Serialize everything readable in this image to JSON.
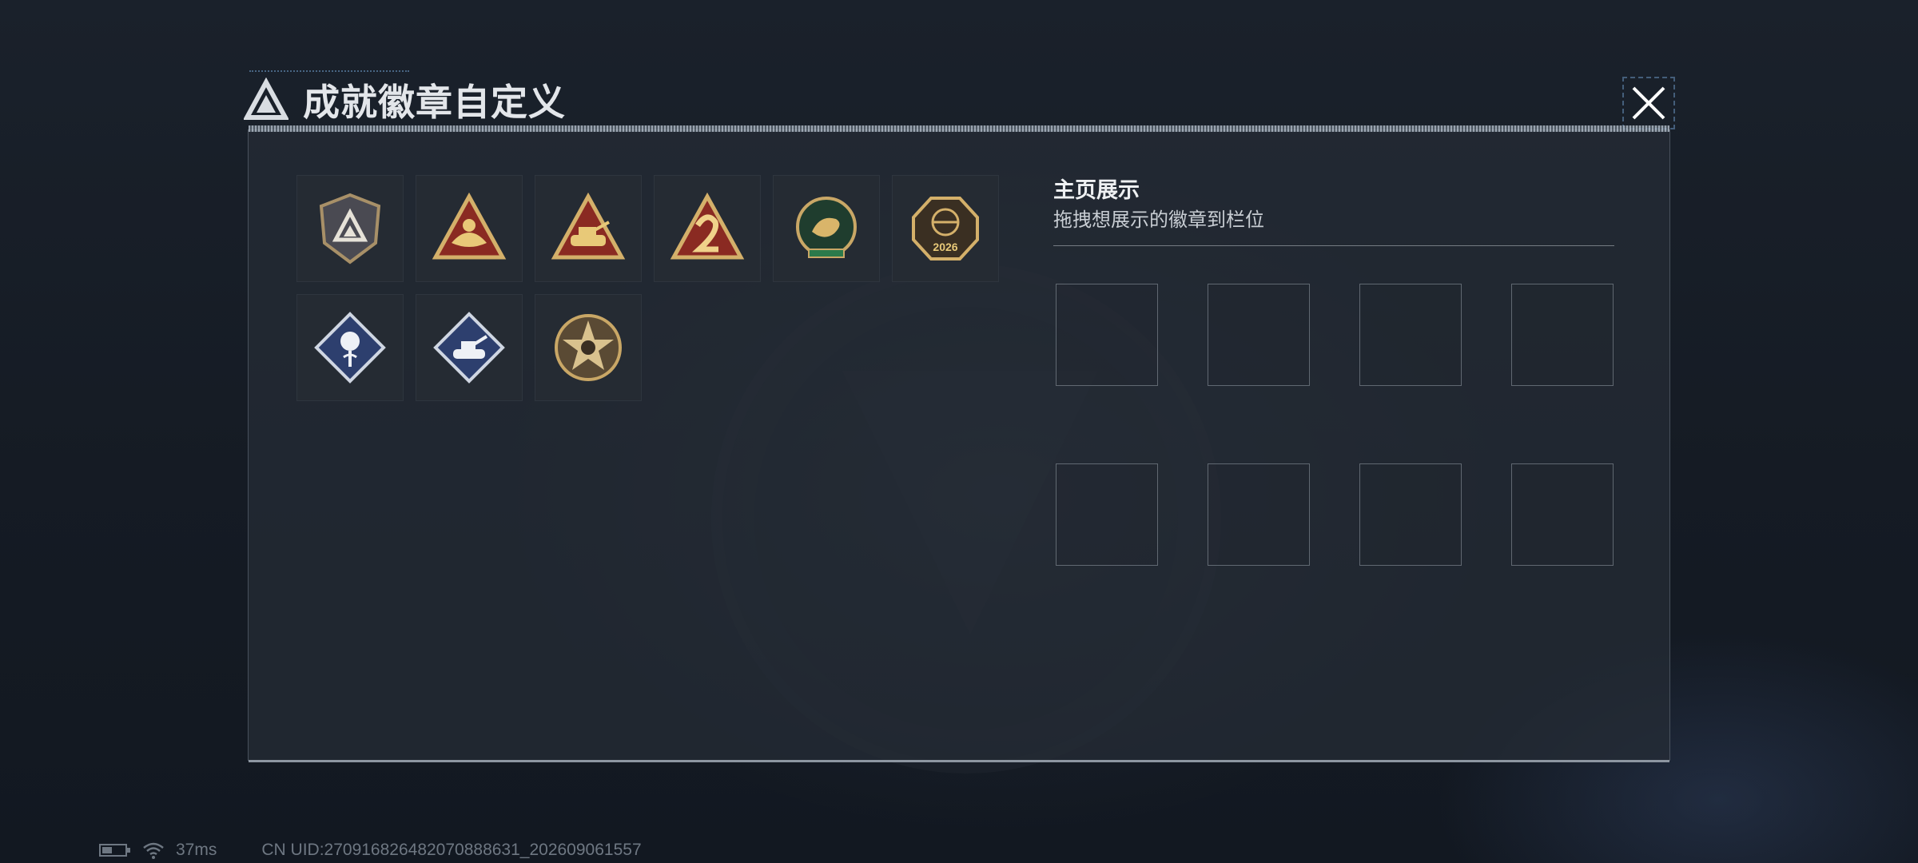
{
  "header": {
    "title": "成就徽章自定义",
    "logo_icon": "delta-triangle-logo",
    "close_icon": "close-icon"
  },
  "badges": [
    {
      "name": "shield-delta-badge"
    },
    {
      "name": "hands-triangle-badge"
    },
    {
      "name": "tank-triangle-badge"
    },
    {
      "name": "number-two-flame-badge"
    },
    {
      "name": "dragon-delta-force-badge"
    },
    {
      "name": "delta-force-2026-badge",
      "text": "2026"
    },
    {
      "name": "rose-diamond-badge"
    },
    {
      "name": "tank-diamond-badge"
    },
    {
      "name": "skull-star-badge"
    }
  ],
  "showcase": {
    "title": "主页展示",
    "subtitle": "拖拽想展示的徽章到栏位",
    "slot_count": 8
  },
  "status": {
    "ping": "37ms",
    "uid": "CN UID:270916826482070888631_202609061557",
    "battery_icon": "battery-icon",
    "wifi_icon": "wifi-icon"
  },
  "colors": {
    "gold": "#c9a766",
    "panel": "#262c36",
    "text": "#e3e6ea"
  }
}
